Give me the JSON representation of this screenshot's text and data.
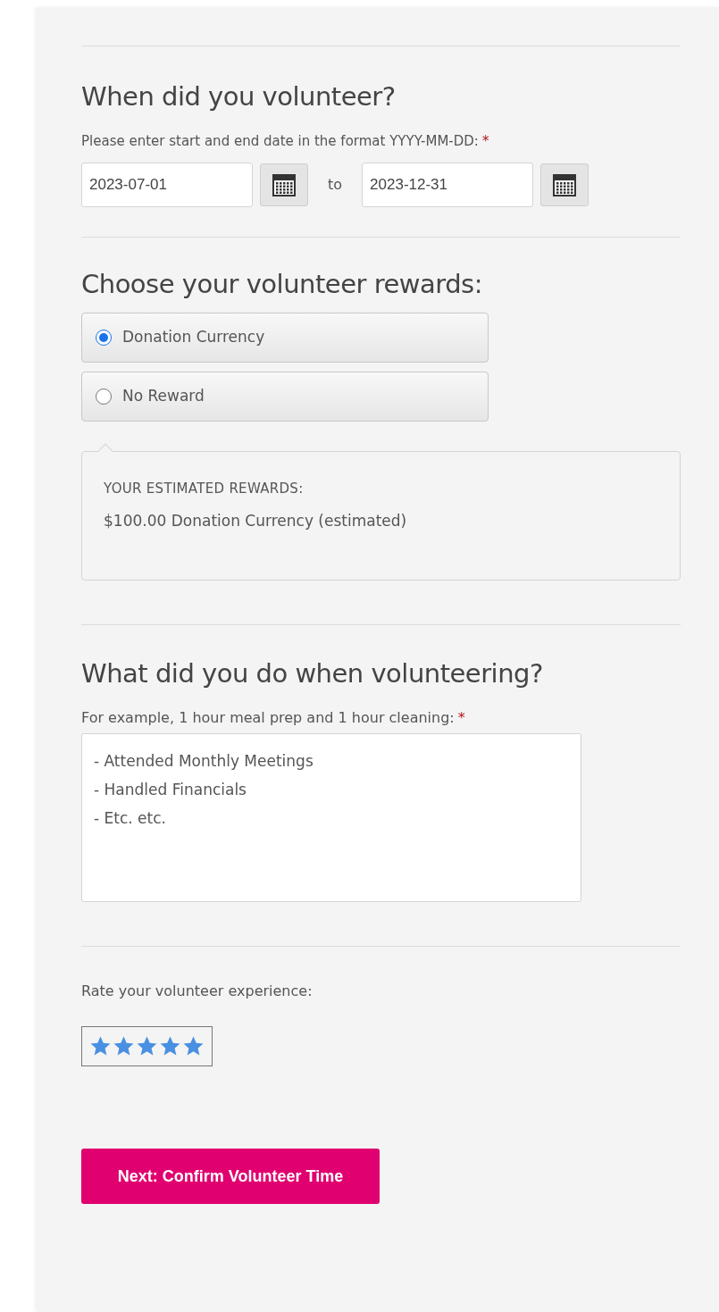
{
  "dates": {
    "heading": "When did you volunteer?",
    "label": "Please enter start and end date in the format YYYY-MM-DD:",
    "required_mark": "*",
    "start": "2023-07-01",
    "separator": "to",
    "end": "2023-12-31"
  },
  "rewards": {
    "heading": "Choose your volunteer rewards:",
    "options": [
      {
        "label": "Donation Currency",
        "selected": true
      },
      {
        "label": "No Reward",
        "selected": false
      }
    ],
    "estimate_title": "YOUR ESTIMATED REWARDS:",
    "estimate": "$100.00 Donation Currency (estimated)"
  },
  "activities": {
    "heading": "What did you do when volunteering?",
    "label": "For example, 1 hour meal prep and 1 hour cleaning:",
    "required_mark": "*",
    "value": "- Attended Monthly Meetings\n- Handled Financials\n- Etc. etc."
  },
  "rating": {
    "label": "Rate your volunteer experience:",
    "stars": 5
  },
  "submit": "Next: Confirm Volunteer Time"
}
